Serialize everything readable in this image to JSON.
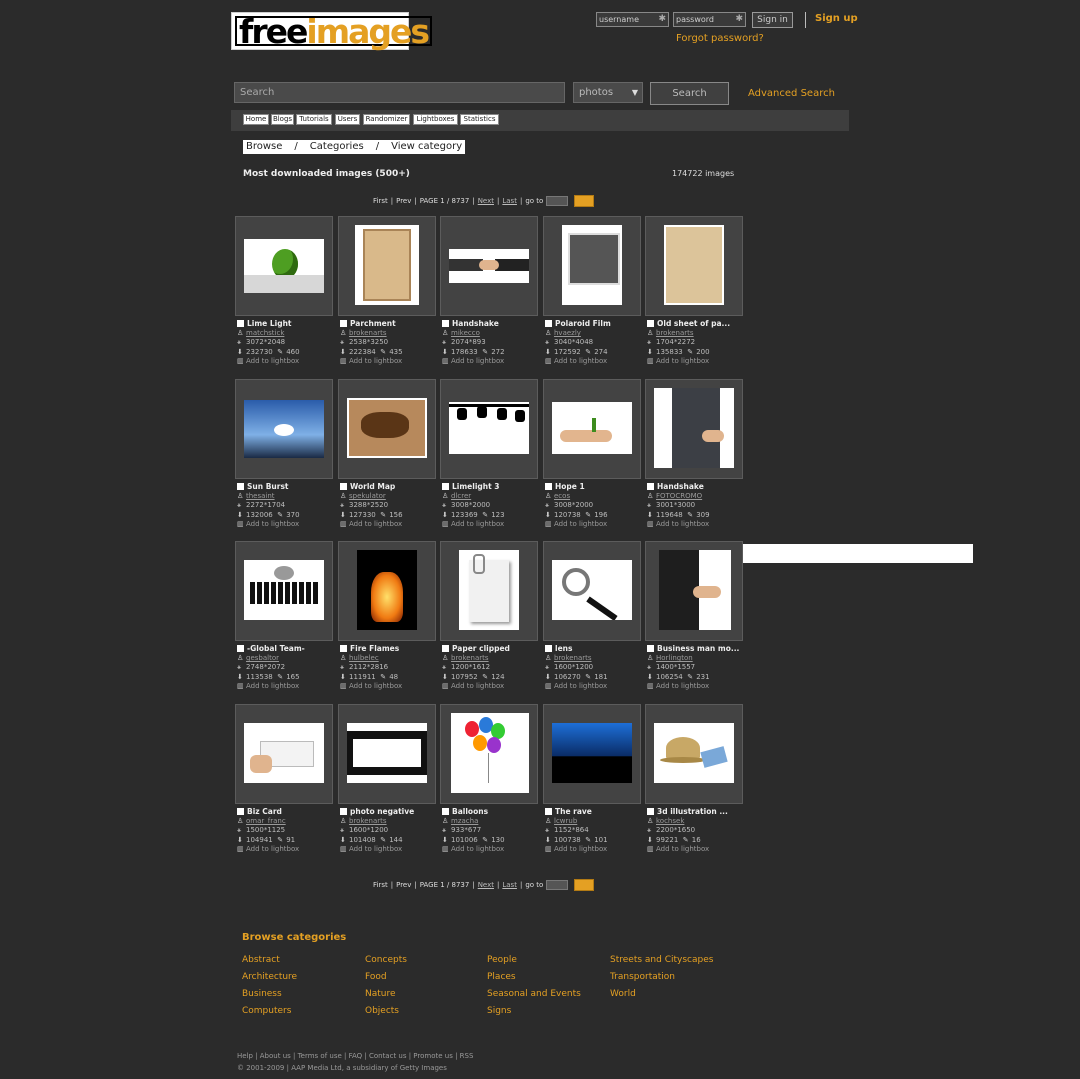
{
  "header": {
    "logo_free": "free",
    "logo_images": "images",
    "username_placeholder": "username",
    "password_placeholder": "password",
    "signin_label": "Sign in",
    "signup_label": "Sign up",
    "forgot_label": "Forgot password?"
  },
  "search": {
    "placeholder": "Search",
    "select_value": "photos",
    "button_label": "Search",
    "advanced_label": "Advanced Search"
  },
  "nav": [
    "Home",
    "Blogs",
    "Tutorials",
    "Users",
    "Randomizer",
    "Lightboxes",
    "Statistics"
  ],
  "breadcrumb": {
    "browse": "Browse",
    "sep": "/",
    "categories": "Categories",
    "view": "View category"
  },
  "heading": "Most downloaded images (500+)",
  "image_count": "174722 images",
  "pager": {
    "first": "First",
    "prev": "Prev",
    "page": "PAGE 1 / 8737",
    "next": "Next",
    "last": "Last",
    "goto": "go to",
    "go": "GO"
  },
  "add_label": "Add to lightbox",
  "images": [
    {
      "title": "Lime Light",
      "user": "matchstick",
      "size": "3072*2048",
      "downloads": "232730",
      "likes": "460"
    },
    {
      "title": "Parchment",
      "user": "brokenarts",
      "size": "2538*3250",
      "downloads": "222384",
      "likes": "435"
    },
    {
      "title": "Handshake",
      "user": "mikecco",
      "size": "2074*893",
      "downloads": "178633",
      "likes": "272"
    },
    {
      "title": "Polaroid Film",
      "user": "hvaezly",
      "size": "3040*4048",
      "downloads": "172592",
      "likes": "274"
    },
    {
      "title": "Old sheet of pa...",
      "user": "brokenarts",
      "size": "1704*2272",
      "downloads": "135833",
      "likes": "200"
    },
    {
      "title": "Sun Burst",
      "user": "thesaint",
      "size": "2272*1704",
      "downloads": "132006",
      "likes": "370"
    },
    {
      "title": "World Map",
      "user": "spekulator",
      "size": "3288*2520",
      "downloads": "127330",
      "likes": "156"
    },
    {
      "title": "Limelight 3",
      "user": "dlcrer",
      "size": "3008*2000",
      "downloads": "123369",
      "likes": "123"
    },
    {
      "title": "Hope 1",
      "user": "ecos",
      "size": "3008*2000",
      "downloads": "120738",
      "likes": "196"
    },
    {
      "title": "Handshake",
      "user": "FOTOCROMO",
      "size": "3001*3000",
      "downloads": "119648",
      "likes": "309"
    },
    {
      "title": "-Global Team-",
      "user": "gesbaltor",
      "size": "2748*2072",
      "downloads": "113538",
      "likes": "165"
    },
    {
      "title": "Fire Flames",
      "user": "hulbelec",
      "size": "2112*2816",
      "downloads": "111911",
      "likes": "48"
    },
    {
      "title": "Paper clipped",
      "user": "brokenarts",
      "size": "1200*1612",
      "downloads": "107952",
      "likes": "124"
    },
    {
      "title": "lens",
      "user": "brokenarts",
      "size": "1600*1200",
      "downloads": "106270",
      "likes": "181"
    },
    {
      "title": "Business man mo...",
      "user": "Horlington",
      "size": "1400*1557",
      "downloads": "106254",
      "likes": "231"
    },
    {
      "title": "Biz Card",
      "user": "omar_franc",
      "size": "1500*1125",
      "downloads": "104941",
      "likes": "91"
    },
    {
      "title": "photo negative",
      "user": "brokenarts",
      "size": "1600*1200",
      "downloads": "101408",
      "likes": "144"
    },
    {
      "title": "Balloons",
      "user": "mzacha",
      "size": "933*677",
      "downloads": "101006",
      "likes": "130"
    },
    {
      "title": "The rave",
      "user": "lcwrub",
      "size": "1152*864",
      "downloads": "100738",
      "likes": "101"
    },
    {
      "title": "3d illustration ...",
      "user": "kochsek",
      "size": "2200*1650",
      "downloads": "99221",
      "likes": "16"
    }
  ],
  "browse_title": "Browse categories",
  "categories": [
    "Abstract",
    "Concepts",
    "People",
    "Streets and Cityscapes",
    "Architecture",
    "Food",
    "Places",
    "Transportation",
    "Business",
    "Nature",
    "Seasonal and Events",
    "World",
    "Computers",
    "Objects",
    "Signs"
  ],
  "footer_links": "Help | About us | Terms of use | FAQ | Contact us | Promote us | RSS",
  "copyright": "© 2001-2009 | AAP Media Ltd, a subsidiary of Getty Images"
}
